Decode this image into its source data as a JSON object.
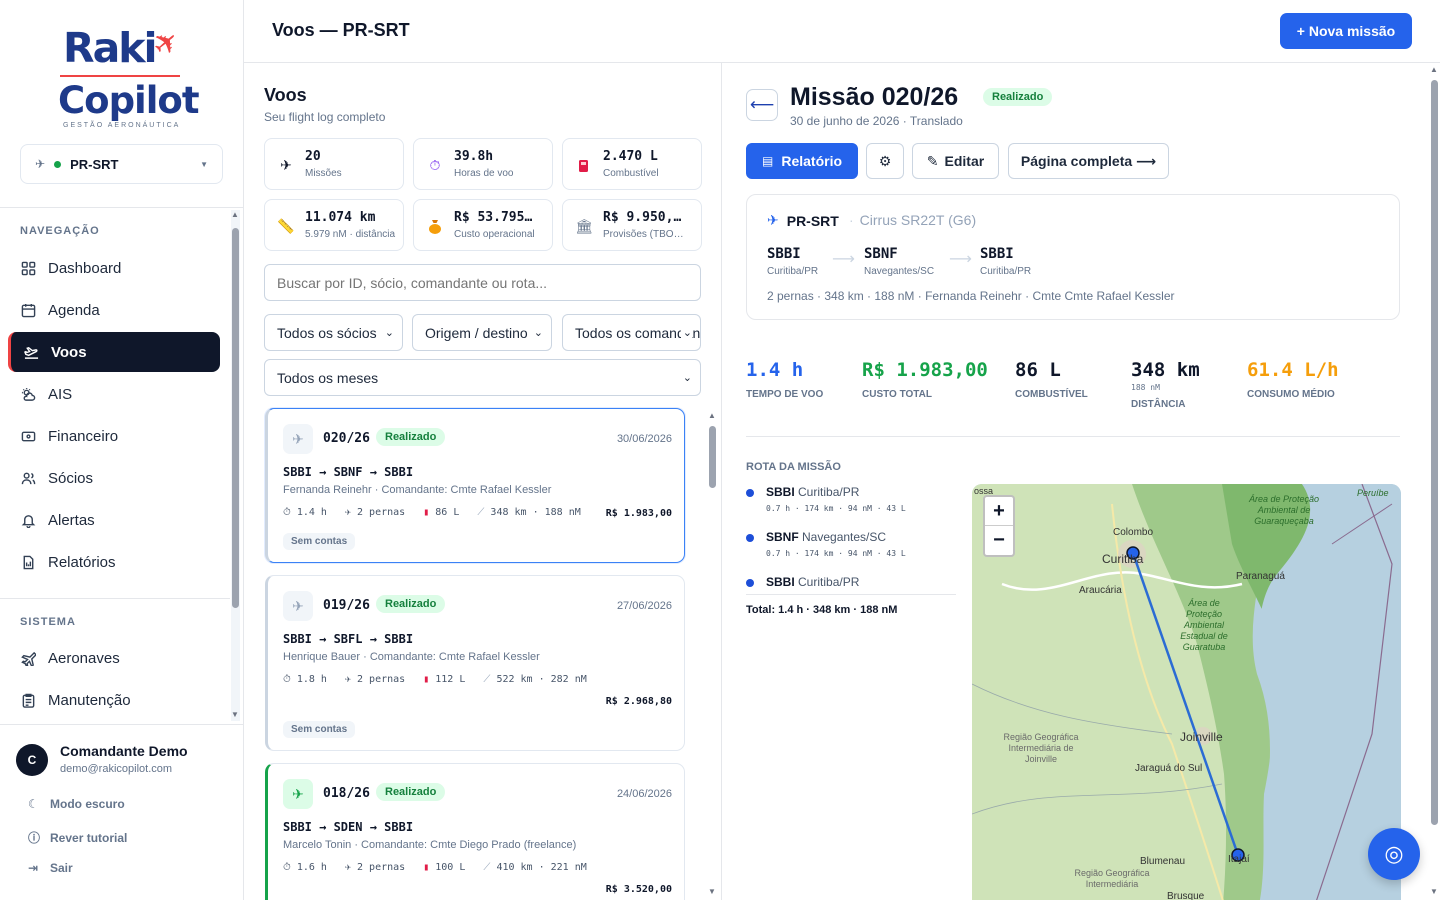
{
  "app": {
    "logo_line1": "Raki",
    "logo_line2": "Copilot",
    "logo_tagline": "GESTÃO AERONÁUTICA"
  },
  "aircraft_selector": {
    "value": "PR-SRT"
  },
  "nav": {
    "section1": "NAVEGAÇÃO",
    "section2": "SISTEMA",
    "items": [
      {
        "label": "Dashboard",
        "icon": "grid-icon"
      },
      {
        "label": "Agenda",
        "icon": "calendar-icon"
      },
      {
        "label": "Voos",
        "icon": "flight-icon"
      },
      {
        "label": "AIS",
        "icon": "weather-icon"
      },
      {
        "label": "Financeiro",
        "icon": "wallet-icon"
      },
      {
        "label": "Sócios",
        "icon": "users-icon"
      },
      {
        "label": "Alertas",
        "icon": "bell-icon"
      },
      {
        "label": "Relatórios",
        "icon": "report-icon"
      }
    ],
    "system_items": [
      {
        "label": "Aeronaves",
        "icon": "plane-icon"
      },
      {
        "label": "Manutenção",
        "icon": "clipboard-icon"
      }
    ]
  },
  "user": {
    "initial": "C",
    "name": "Comandante Demo",
    "email": "demo@rakicopilot.com",
    "links": [
      "Modo escuro",
      "Rever tutorial",
      "Sair"
    ]
  },
  "header": {
    "title": "Voos — PR-SRT",
    "new_button": "+ Nova missão"
  },
  "flights": {
    "title": "Voos",
    "subtitle": "Seu flight log completo",
    "stats": [
      {
        "value": "20",
        "label": "Missões",
        "icon": "plane-icon"
      },
      {
        "value": "39.8h",
        "label": "Horas de voo",
        "icon": "stopwatch-icon"
      },
      {
        "value": "2.470 L",
        "label": "Combustível",
        "icon": "fuel-icon"
      },
      {
        "value": "11.074 km",
        "label": "5.979 nM · distância",
        "icon": "ruler-icon"
      },
      {
        "value": "R$ 53.795…",
        "label": "Custo operacional",
        "icon": "money-bag-icon"
      },
      {
        "value": "R$ 9.950,…",
        "label": "Provisões (TBO…",
        "icon": "bank-icon"
      }
    ],
    "search_placeholder": "Buscar por ID, sócio, comandante ou rota...",
    "filters": [
      "Todos os sócios",
      "Origem / destino",
      "Todos os comandantes",
      "Todos os meses"
    ],
    "cards": [
      {
        "id": "020/26",
        "status": "Realizado",
        "date": "30/06/2026",
        "route": "SBBI → SBNF → SBBI",
        "crew": "Fernanda Reinehr · Comandante: Cmte Rafael Kessler",
        "hours": "1.4 h",
        "legs": "2 pernas",
        "fuel": "86 L",
        "distance": "348 km · 188 nM",
        "cost": "R$ 1.983,00",
        "tag": "Sem contas"
      },
      {
        "id": "019/26",
        "status": "Realizado",
        "date": "27/06/2026",
        "route": "SBBI → SBFL → SBBI",
        "crew": "Henrique Bauer · Comandante: Cmte Rafael Kessler",
        "hours": "1.8 h",
        "legs": "2 pernas",
        "fuel": "112 L",
        "distance": "522 km · 282 nM",
        "cost": "R$ 2.968,80",
        "tag": "Sem contas"
      },
      {
        "id": "018/26",
        "status": "Realizado",
        "date": "24/06/2026",
        "route": "SBBI → SDEN → SBBI",
        "crew": "Marcelo Tonin · Comandante: Cmte Diego Prado (freelance)",
        "hours": "1.6 h",
        "legs": "2 pernas",
        "fuel": "100 L",
        "distance": "410 km · 221 nM",
        "cost": "R$ 3.520,00"
      }
    ]
  },
  "detail": {
    "title": "Missão 020/26",
    "status": "Realizado",
    "date": "30 de junho de 2026 · Translado",
    "buttons": {
      "report": "Relatório",
      "settings": "⚙",
      "edit": "Editar",
      "full": "Página completa ⟶"
    },
    "aircraft": "PR-SRT",
    "model": "Cirrus SR22T (G6)",
    "legs": [
      {
        "code": "SBBI",
        "name": "Curitiba/PR"
      },
      {
        "code": "SBNF",
        "name": "Navegantes/SC"
      },
      {
        "code": "SBBI",
        "name": "Curitiba/PR"
      }
    ],
    "summary": "2 pernas · 348 km · 188 nM · Fernanda Reinehr · Cmte Cmte Rafael Kessler",
    "kpis": [
      {
        "value": "1.4 h",
        "label": "TEMPO DE VOO",
        "color": "#2563eb"
      },
      {
        "value": "R$ 1.983,00",
        "label": "CUSTO TOTAL",
        "color": "#16a34a"
      },
      {
        "value": "86 L",
        "label": "COMBUSTÍVEL",
        "color": "#0f172a"
      },
      {
        "value": "348 km",
        "sub": "188 nM",
        "label": "DISTÂNCIA",
        "color": "#0f172a"
      },
      {
        "value": "61.4 L/h",
        "label": "CONSUMO MÉDIO",
        "color": "#f59e0b"
      }
    ],
    "route_title": "ROTA DA MISSÃO",
    "stops": [
      {
        "code": "SBBI",
        "city": "Curitiba/PR",
        "detail": "0.7 h · 174 km · 94 nM · 43 L"
      },
      {
        "code": "SBNF",
        "city": "Navegantes/SC",
        "detail": "0.7 h · 174 km · 94 nM · 43 L"
      },
      {
        "code": "SBBI",
        "city": "Curitiba/PR"
      }
    ],
    "total": "Total: 1.4 h · 348 km · 188 nM",
    "map_labels": [
      "Colombo",
      "Curitiba",
      "Araucária",
      "Paranaguá",
      "Joinville",
      "Jaraguá do Sul",
      "Blumenau",
      "Itajaí",
      "Brusque",
      "Peruíbe",
      "Área de Proteção Ambiental de Guaraqueçaba",
      "Área de Proteção Ambiental Estadual de Guaratuba",
      "Região Geográfica Intermediária de Joinville",
      "Região Geográfica Intermediária",
      "ossa"
    ]
  }
}
